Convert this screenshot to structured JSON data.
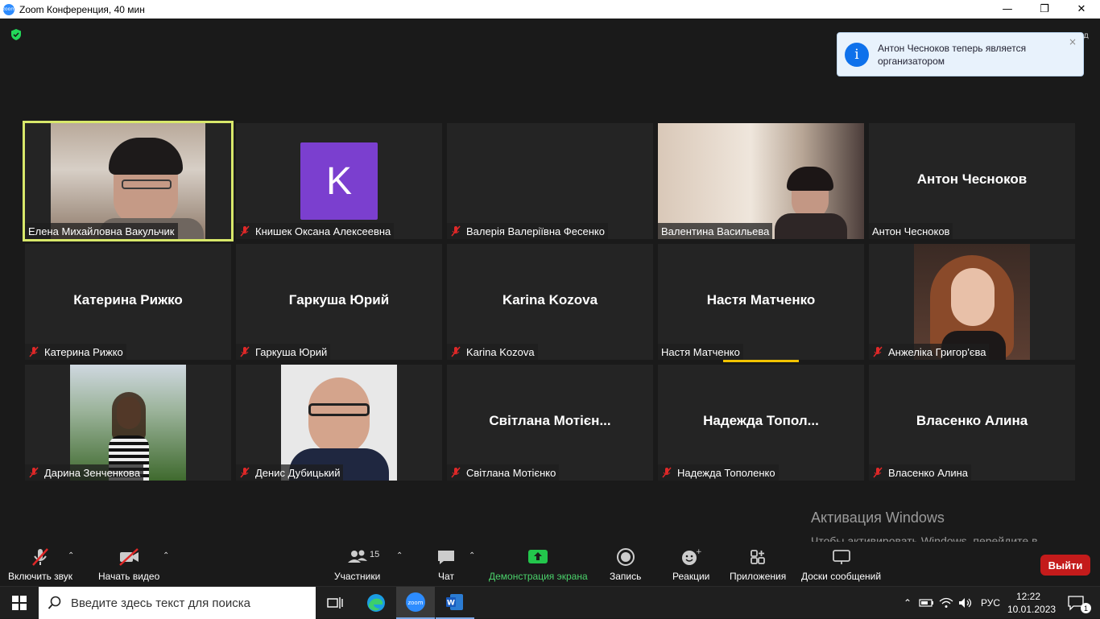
{
  "window": {
    "title": "Zoom Конференция, 40 мин",
    "app_icon": "zoom",
    "view_button": "Вид"
  },
  "toast": {
    "message": "Антон Чесноков теперь является организатором",
    "close": "×"
  },
  "participants": [
    {
      "name": "Елена Михайловна Вакульчик",
      "muted": false,
      "video": true,
      "active": true
    },
    {
      "name": "Книшек Оксана Алексеевна",
      "muted": true,
      "video": false,
      "avatar_letter": "K",
      "avatar_color": "#7b3fcf"
    },
    {
      "name": "Валерія Валеріївна Фесенко",
      "muted": true,
      "video": false
    },
    {
      "name": "Валентина Васильева",
      "muted": false,
      "video": true
    },
    {
      "name": "Антон Чесноков",
      "muted": false,
      "video": false,
      "display": "Антон Чесноков"
    },
    {
      "name": "Катерина Рижко",
      "muted": true,
      "video": false,
      "display": "Катерина Рижко"
    },
    {
      "name": "Гаркуша Юрий",
      "muted": true,
      "video": false,
      "display": "Гаркуша Юрий"
    },
    {
      "name": "Karina Kozova",
      "muted": true,
      "video": false,
      "display": "Karina Kozova"
    },
    {
      "name": "Настя Матченко",
      "muted": false,
      "video": false,
      "display": "Настя Матченко",
      "speaking": true
    },
    {
      "name": "Анжеліка Григор'єва",
      "muted": true,
      "video": true
    },
    {
      "name": "Дарина Зенченкова",
      "muted": true,
      "video": true
    },
    {
      "name": "Денис Дубицький",
      "muted": true,
      "video": true
    },
    {
      "name": "Світлана Мотієнко",
      "muted": true,
      "video": false,
      "display": "Світлана  Мотієн..."
    },
    {
      "name": "Надежда Тополенко",
      "muted": true,
      "video": false,
      "display": "Надежда  Топол..."
    },
    {
      "name": "Власенко Алина",
      "muted": true,
      "video": false,
      "display": "Власенко Алина"
    }
  ],
  "activation": {
    "title": "Активация Windows",
    "text": "Чтобы активировать Windows, перейдите в раздел \"Параметры\"."
  },
  "toolbar": {
    "unmute": "Включить звук",
    "start_video": "Начать видео",
    "participants": "Участники",
    "participants_count": "15",
    "chat": "Чат",
    "share": "Демонстрация экрана",
    "record": "Запись",
    "reactions": "Реакции",
    "apps": "Приложения",
    "whiteboards": "Доски сообщений",
    "leave": "Выйти",
    "share_color": "#4bd16b",
    "leave_color": "#c41b1b"
  },
  "taskbar": {
    "search_placeholder": "Введите здесь текст для поиска",
    "language": "РУС",
    "time": "12:22",
    "date": "10.01.2023",
    "notifications": "1"
  }
}
